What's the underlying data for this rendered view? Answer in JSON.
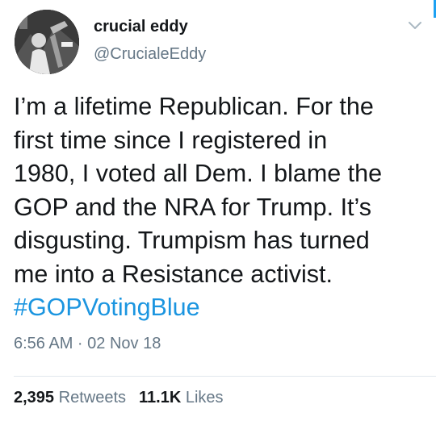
{
  "author": {
    "display_name": "crucial eddy",
    "handle": "@CrucialeEddy",
    "avatar_icon": "profile-photo"
  },
  "menu_icon": "chevron-down-icon",
  "tweet": {
    "lines": [
      "I’m a lifetime Republican. For the",
      "first time since I registered in",
      "1980, I voted all Dem. I blame the",
      "GOP and the NRA for Trump. It’s",
      "disgusting. Trumpism has turned",
      "me into a Resistance activist."
    ],
    "hashtag": "#GOPVotingBlue",
    "timestamp": "6:56 AM · 02 Nov 18"
  },
  "stats": {
    "retweets_count": "2,395",
    "retweets_label": "Retweets",
    "likes_count": "11.1K",
    "likes_label": "Likes"
  },
  "colors": {
    "text": "#14171a",
    "secondary": "#657786",
    "link": "#1b95e0",
    "divider": "#e1e8ed"
  }
}
